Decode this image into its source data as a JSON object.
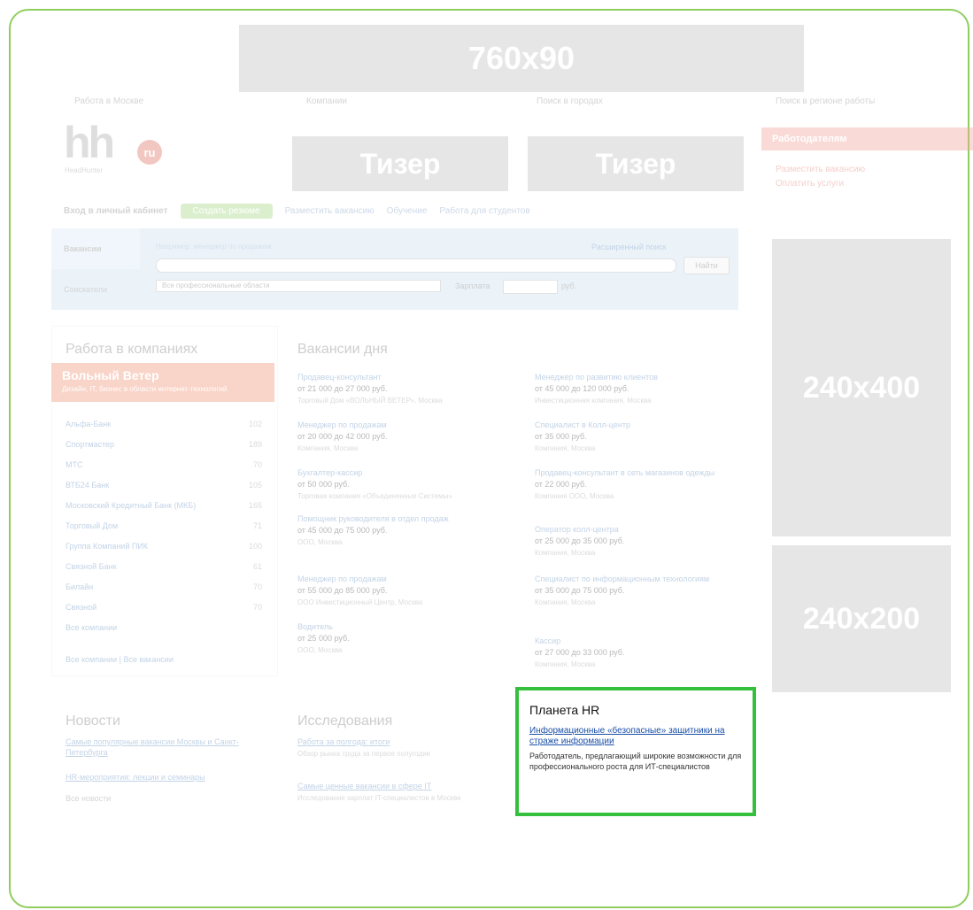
{
  "banner_top": "760x90",
  "banner_right_tall": "240x400",
  "banner_right_short": "240x200",
  "teasers": [
    "Тизер",
    "Тизер"
  ],
  "top_links": [
    "Работа в Москве",
    "Компании",
    "Поиск в городах",
    "Поиск в регионе работы"
  ],
  "logo": {
    "text": "hh",
    "badge": "ru",
    "sub": "HeadHunter"
  },
  "employer": {
    "title": "Работодателям",
    "links": [
      "Разместить вакансию",
      "Оплатить услуги"
    ]
  },
  "nav": {
    "login": "Вход в личный кабинет",
    "create_resume": "Создать резюме",
    "items": [
      "Разместить вакансию",
      "Обучение",
      "Работа для студентов"
    ]
  },
  "search": {
    "tabs": [
      "Вакансии",
      "Соискатели"
    ],
    "hint": "Например: менеджер по продажам",
    "advanced": "Расширенный поиск",
    "button": "Найти",
    "select": "Все профессиональные области",
    "salary_label": "Зарплата",
    "currency": "руб."
  },
  "companies": {
    "title": "Работа в компаниях",
    "featured": {
      "name": "Вольный Ветер",
      "desc": "Дизайн, IT, бизнес в области интернет-технологий"
    },
    "rows": [
      {
        "name": "Альфа-Банк",
        "count": "102"
      },
      {
        "name": "Спортмастер",
        "count": "189"
      },
      {
        "name": "МТС",
        "count": "70"
      },
      {
        "name": "ВТБ24 Банк",
        "count": "105"
      },
      {
        "name": "Московский Кредитный Банк (МКБ)",
        "count": "165"
      },
      {
        "name": "Торговый Дом",
        "count": "71"
      },
      {
        "name": "Группа Компаний ПИК",
        "count": "100"
      },
      {
        "name": "Связной Банк",
        "count": "61"
      },
      {
        "name": "Билайн",
        "count": "70"
      },
      {
        "name": "Связной",
        "count": "70"
      },
      {
        "name": "Все компании",
        "count": ""
      }
    ],
    "footer": "Все компании  |  Все вакансии"
  },
  "vacancies": {
    "title": "Вакансии дня",
    "left": [
      {
        "title": "Продавец-консультант",
        "salary": "от 21 000 до 27 000 руб.",
        "company": "Торговый Дом «ВОЛЬНЫЙ ВЕТЕР», Москва"
      },
      {
        "title": "Менеджер по продажам",
        "salary": "от 20 000 до 42 000 руб.",
        "company": "Компания, Москва"
      },
      {
        "title": "Бухгалтер-кассир",
        "salary": "от 50 000 руб.",
        "company": "Торговая компания «Объединенные Системы»"
      },
      {
        "title": "Помощник руководителя в отдел продаж",
        "salary": "от 45 000 до 75 000 руб.",
        "company": "ООО, Москва"
      },
      {
        "title": "Менеджер по продажам",
        "salary": "от 55 000 до 85 000 руб.",
        "company": "ООО Инвестиционный Центр, Москва"
      },
      {
        "title": "Водитель",
        "salary": "от 25 000 руб.",
        "company": "ООО, Москва"
      }
    ],
    "right": [
      {
        "title": "Менеджер по развитию клиентов",
        "salary": "от 45 000 до 120 000 руб.",
        "company": "Инвестиционная компания, Москва"
      },
      {
        "title": "Специалист в Колл-центр",
        "salary": "от 35 000 руб.",
        "company": "Компания, Москва"
      },
      {
        "title": "Продавец-консультант в сеть магазинов одежды",
        "salary": "от 22 000 руб.",
        "company": "Компания ООО, Москва"
      },
      {
        "title": "Оператор колл-центра",
        "salary": "от 25 000 до 35 000 руб.",
        "company": "Компания, Москва"
      },
      {
        "title": "Специалист по информационным технологиям",
        "salary": "от 35 000 до 75 000 руб.",
        "company": "Компания, Москва"
      },
      {
        "title": "Кассир",
        "salary": "от 27 000 до 33 000 руб.",
        "company": "Компания, Москва"
      }
    ]
  },
  "news": {
    "title": "Новости",
    "items": [
      "Самые популярные вакансии Москвы и Санкт-Петербурга",
      "HR-мероприятия: лекции и семинары",
      "Все новости"
    ]
  },
  "research": {
    "title": "Исследования",
    "items": [
      {
        "link": "Работа за полгода: итоги",
        "desc": "Обзор рынка труда за первое полугодие"
      },
      {
        "link": "Самые ценные вакансии в сфере IT",
        "desc": "Исследование зарплат IT-специалистов в Москве"
      }
    ]
  },
  "hr_planet": {
    "title": "Планета HR",
    "link": "Информационные «безопасные» защитники на страже информации",
    "desc": "Работодатель, предлагающий широкие возможности для профессионального роста для ИТ-специалистов"
  }
}
